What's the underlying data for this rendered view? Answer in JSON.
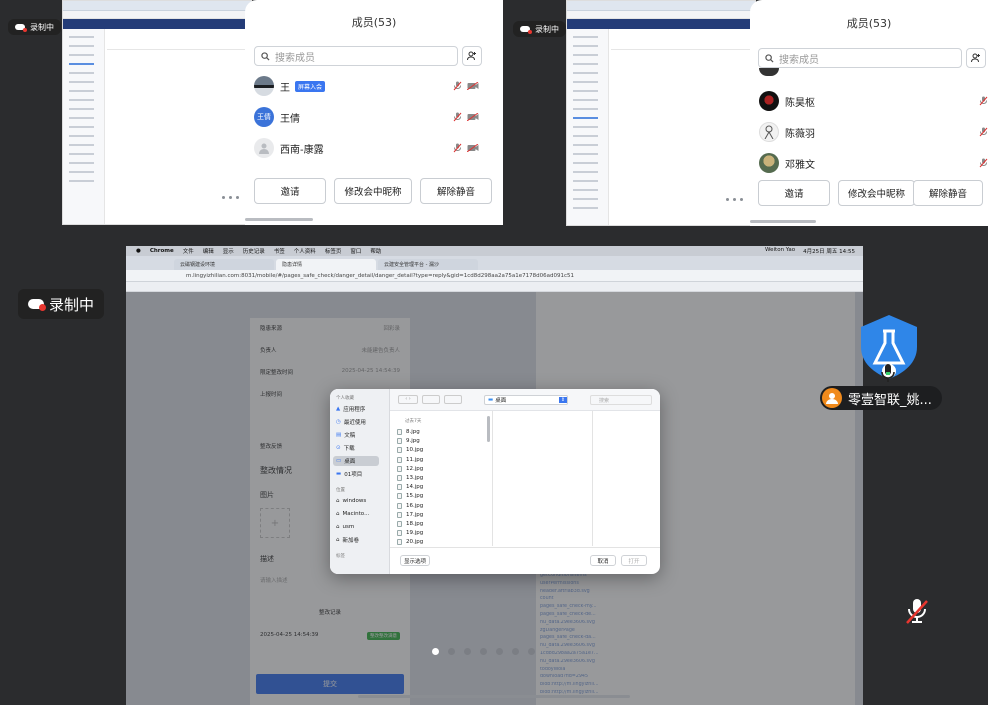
{
  "recording_label": "录制中",
  "members_panel_left": {
    "title": "成员(53)",
    "search_placeholder": "搜索成员",
    "members": [
      {
        "name": "王",
        "tag": "屏幕入会",
        "avatar_text": ""
      },
      {
        "name": "王倩",
        "tag": "",
        "avatar_text": "王倩"
      },
      {
        "name": "西南-康露",
        "tag": "",
        "avatar_text": ""
      }
    ],
    "buttons": [
      "邀请",
      "修改会中昵称",
      "解除静音"
    ]
  },
  "members_panel_right": {
    "title": "成员(53)",
    "search_placeholder": "搜索成员",
    "members": [
      {
        "name": "陈昊枢"
      },
      {
        "name": "陈薇羽"
      },
      {
        "name": "邓雅文"
      }
    ],
    "buttons": [
      "邀请",
      "修改会中昵称",
      "解除静音"
    ]
  },
  "shared_screen": {
    "menubar": [
      "Chrome",
      "文件",
      "编辑",
      "显示",
      "历史记录",
      "书签",
      "个人资料",
      "标签页",
      "窗口",
      "帮助"
    ],
    "menubar_right": [
      "Weiton Yao",
      "4月25日 周五 14:55"
    ],
    "tabs": [
      "云磁钢建设环境",
      "隐患详情",
      "云建安全管理平台 - 漏沙"
    ],
    "url": "m.lingyizhilian.com:8031/mobile/#/pages_safe_check/danger_detail/danger_detail?type=reply&gid=1cd8d298aa2a75a1e7178d06ad091c51",
    "mobile": {
      "header": "隐患来源",
      "header_value": "回彩录",
      "rows": [
        {
          "label": "负责人",
          "value": "未能建告负责人"
        },
        {
          "label": "限定整改时间",
          "value": "2025-04-25 14:54:39"
        },
        {
          "label": "上报时间",
          "value": ""
        },
        {
          "label": "整改反馈",
          "value": ""
        }
      ],
      "rectify_label": "整改情况",
      "image_label": "图片",
      "desc_label": "描述",
      "desc_placeholder": "请输入描述",
      "record_label": "整改记录",
      "record_time": "2025-04-25 14:54:39",
      "record_status": "整改整改满意",
      "submit": "提交"
    },
    "file_dialog": {
      "location": "桌面",
      "search_placeholder": "搜索",
      "sidebar_head_1": "个人收藏",
      "sidebar": [
        "应用程序",
        "最近使用",
        "文稿",
        "下载",
        "桌面",
        "01项目"
      ],
      "sidebar_head_2": "位置",
      "locations": [
        "windows",
        "Macinto...",
        "usm",
        "新加卷"
      ],
      "sidebar_head_3": "标签",
      "list_head": "过去7天",
      "files": [
        "8.jpg",
        "9.jpg",
        "10.jpg",
        "11.jpg",
        "12.jpg",
        "13.jpg",
        "14.jpg",
        "15.jpg",
        "16.jpg",
        "17.jpg",
        "18.jpg",
        "19.jpg",
        "20.jpg"
      ],
      "options_button": "显示选项",
      "cancel_button": "取消",
      "open_button": "打开"
    },
    "devtools_files": [
      "getConditionsItems",
      "userPermissions",
      "header.aftrlab3d.svg",
      "count",
      "pages_safe_check-my...",
      "pages_safe_check-de...",
      "nu_data.29ee3606.svg",
      "zgDangerPage",
      "pages_safe_check-da...",
      "nu_data.29ee3606.svg",
      "1cd8d298aa2a75a1e7...",
      "nu_data.29ee3606.svg",
      "todoyWola",
      "download?fid=2945",
      "blob:http://m.lingyizhil...",
      "blob:http://m.lingyizhil..."
    ]
  },
  "participant": {
    "name": "零壹智联_姚..."
  }
}
